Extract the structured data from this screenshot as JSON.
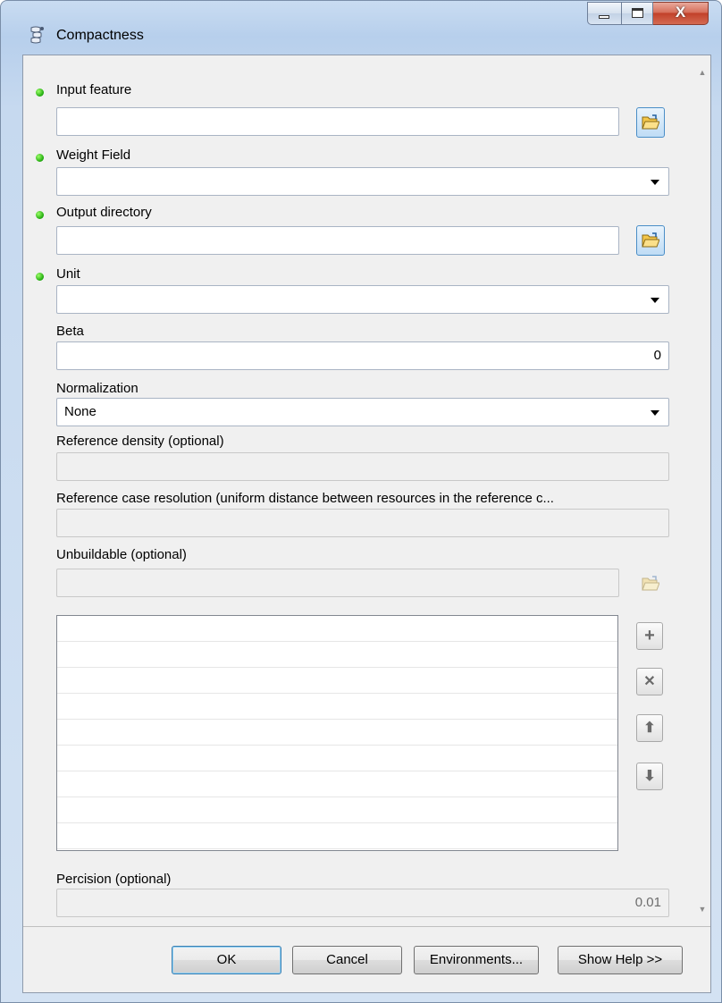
{
  "window": {
    "title": "Compactness"
  },
  "caption_buttons": {
    "close_glyph": "X"
  },
  "params": {
    "input_feature": {
      "label": "Input feature",
      "value": ""
    },
    "weight_field": {
      "label": "Weight Field",
      "value": ""
    },
    "output_directory": {
      "label": "Output directory",
      "value": ""
    },
    "unit": {
      "label": "Unit",
      "value": ""
    },
    "beta": {
      "label": "Beta",
      "value": "0"
    },
    "normalization": {
      "label": "Normalization",
      "value": "None"
    },
    "reference_density": {
      "label": "Reference density (optional)",
      "value": ""
    },
    "reference_case_resolution": {
      "label": "Reference case resolution (uniform distance between resources in the reference c...",
      "value": ""
    },
    "unbuildable": {
      "label": "Unbuildable (optional)",
      "value": ""
    },
    "precision": {
      "label": "Percision (optional)",
      "value": "0.01"
    }
  },
  "list": {
    "rows": [
      "",
      "",
      "",
      "",
      "",
      "",
      "",
      "",
      ""
    ]
  },
  "side_buttons": {
    "add": "+",
    "remove": "✕",
    "up": "⬆",
    "down": "⬇"
  },
  "footer": {
    "ok": "OK",
    "cancel": "Cancel",
    "environments": "Environments...",
    "show_help": "Show Help >>"
  },
  "colors": {
    "required_dot": "#1da80b",
    "close_button": "#c2412a",
    "browse_border": "#4a8ec7"
  },
  "icons": {
    "title": "tool-script-icon",
    "browse": "open-folder-icon",
    "add": "plus-icon",
    "remove": "x-icon",
    "up": "arrow-up-icon",
    "down": "arrow-down-icon"
  }
}
